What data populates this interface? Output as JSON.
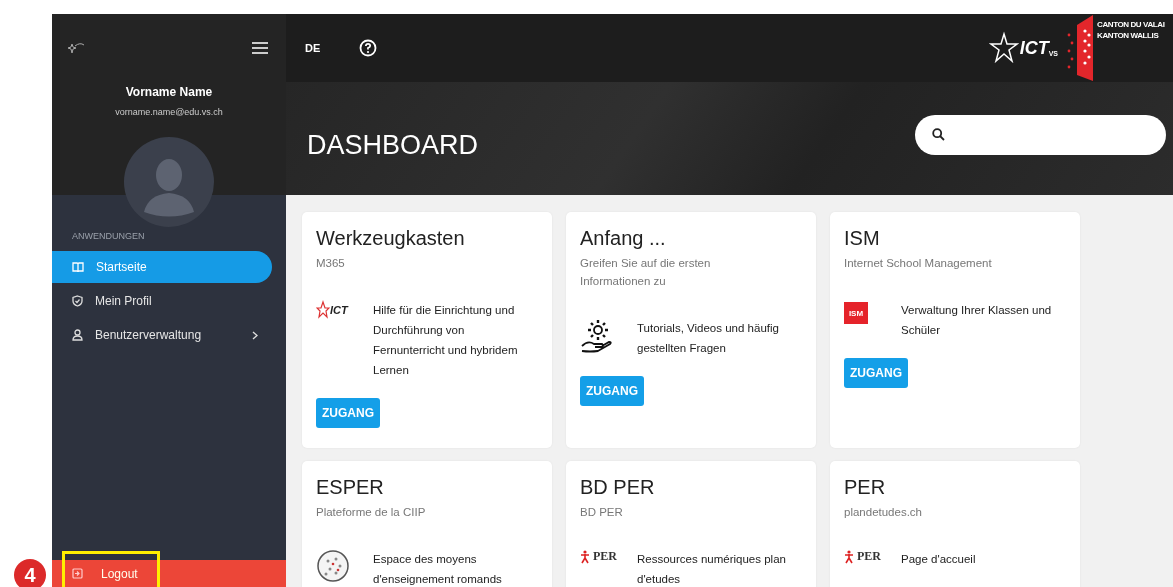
{
  "sidebar": {
    "user": {
      "name": "Vorname Name",
      "email": "vorname.name@edu.vs.ch"
    },
    "section_label": "ANWENDUNGEN",
    "items": [
      {
        "label": "Startseite",
        "kind": "home",
        "selected": true,
        "expandable": false
      },
      {
        "label": "Mein Profil",
        "kind": "profile",
        "selected": false,
        "expandable": false
      },
      {
        "label": "Benutzerverwaltung",
        "kind": "users",
        "selected": false,
        "expandable": true
      }
    ],
    "logout": {
      "label": "Logout"
    }
  },
  "topbar": {
    "language": "DE",
    "logo": {
      "text": "ICT",
      "sub": "VS"
    },
    "canton": [
      "CANTON DU VALAI",
      "KANTON WALLIS"
    ]
  },
  "hero": {
    "title": "DASHBOARD"
  },
  "cards": [
    {
      "title": "Werkzeugkasten",
      "subtitle": "M365",
      "kind": "ict",
      "icon_text": "ICT",
      "description": "Hilfe für die Einrichtung und Durchführung von Fernunterricht und hybridem Lernen",
      "button": "ZUGANG"
    },
    {
      "title": "Anfang ...",
      "subtitle": "Greifen Sie auf die ersten Informationen zu",
      "kind": "gear",
      "description": "Tutorials, Videos und häufig gestellten Fragen",
      "button": "ZUGANG"
    },
    {
      "title": "ISM",
      "subtitle": "Internet School Management",
      "kind": "ism",
      "icon_text": "ISM",
      "description": "Verwaltung Ihrer Klassen und Schüler",
      "button": "ZUGANG"
    },
    {
      "title": "ESPER",
      "subtitle": "Plateforme de la CIIP",
      "kind": "esper",
      "description": "Espace des moyens d'enseignement romands"
    },
    {
      "title": "BD PER",
      "subtitle": "BD PER",
      "kind": "per",
      "icon_text": "PER",
      "description": "Ressources numériques plan d'etudes"
    },
    {
      "title": "PER",
      "subtitle": "plandetudes.ch",
      "kind": "per",
      "icon_text": "PER",
      "description": "Page d'accueil"
    }
  ],
  "annotation": {
    "number": "4"
  }
}
